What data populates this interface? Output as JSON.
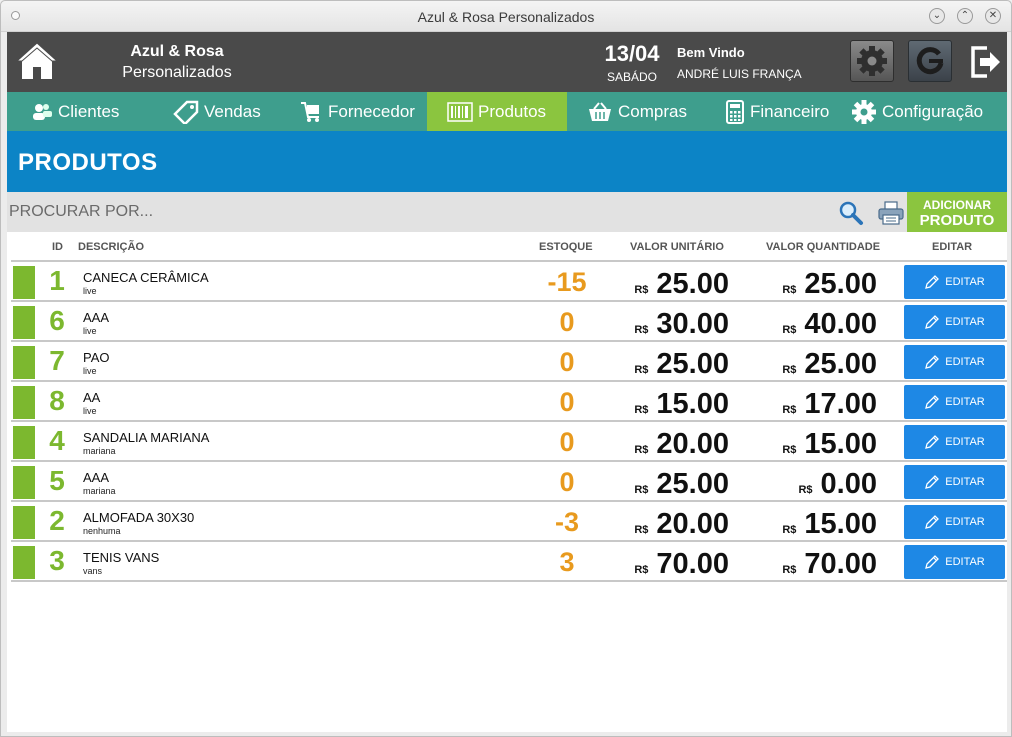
{
  "window": {
    "title": "Azul & Rosa Personalizados",
    "buttons": [
      "⌄",
      "⌃",
      "✕"
    ]
  },
  "header": {
    "brand_line1": "Azul & Rosa",
    "brand_line2": "Personalizados",
    "date": "13/04",
    "weekday": "SABÁDO",
    "welcome": "Bem Vindo",
    "user": "ANDRÉ LUIS FRANÇA"
  },
  "nav": {
    "items": [
      {
        "label": "Clientes",
        "icon": "users-icon"
      },
      {
        "label": "Vendas",
        "icon": "tag-icon"
      },
      {
        "label": "Fornecedor",
        "icon": "cart-icon"
      },
      {
        "label": "Produtos",
        "icon": "barcode-icon",
        "active": true
      },
      {
        "label": "Compras",
        "icon": "basket-icon"
      },
      {
        "label": "Financeiro",
        "icon": "calculator-icon"
      },
      {
        "label": "Configuração",
        "icon": "gear-icon"
      }
    ]
  },
  "page": {
    "title": "PRODUTOS"
  },
  "search": {
    "placeholder": "PROCURAR POR...",
    "add_line1": "ADICIONAR",
    "add_line2": "PRODUTO"
  },
  "table": {
    "headers": {
      "id": "ID",
      "descricao": "DESCRIÇÃO",
      "estoque": "ESTOQUE",
      "valor_unitario": "VALOR UNITÁRIO",
      "valor_quantidade": "VALOR QUANTIDADE",
      "editar": "EDITAR"
    },
    "currency": "R$",
    "edit_label": "EDITAR",
    "rows": [
      {
        "id": "1",
        "desc": "CANECA CERÂMICA",
        "sub": "live",
        "stock": "-15",
        "unit": "25.00",
        "qty": "25.00"
      },
      {
        "id": "6",
        "desc": "AAA",
        "sub": "live",
        "stock": "0",
        "unit": "30.00",
        "qty": "40.00"
      },
      {
        "id": "7",
        "desc": "PAO",
        "sub": "live",
        "stock": "0",
        "unit": "25.00",
        "qty": "25.00"
      },
      {
        "id": "8",
        "desc": "AA",
        "sub": "live",
        "stock": "0",
        "unit": "15.00",
        "qty": "17.00"
      },
      {
        "id": "4",
        "desc": "SANDALIA MARIANA",
        "sub": "mariana",
        "stock": "0",
        "unit": "20.00",
        "qty": "15.00"
      },
      {
        "id": "5",
        "desc": "AAA",
        "sub": "mariana",
        "stock": "0",
        "unit": "25.00",
        "qty": "0.00"
      },
      {
        "id": "2",
        "desc": "ALMOFADA 30X30",
        "sub": "nenhuma",
        "stock": "-3",
        "unit": "20.00",
        "qty": "15.00"
      },
      {
        "id": "3",
        "desc": "TENIS VANS",
        "sub": "vans",
        "stock": "3",
        "unit": "70.00",
        "qty": "70.00"
      }
    ]
  },
  "colors": {
    "header_bg": "#4a4a4a",
    "nav_bg": "#3e9e8d",
    "nav_active": "#8bc53f",
    "title_bg": "#0c84c6",
    "id_green": "#7cb82f",
    "stock_orange": "#e89a1e",
    "edit_blue": "#1e88e5"
  }
}
